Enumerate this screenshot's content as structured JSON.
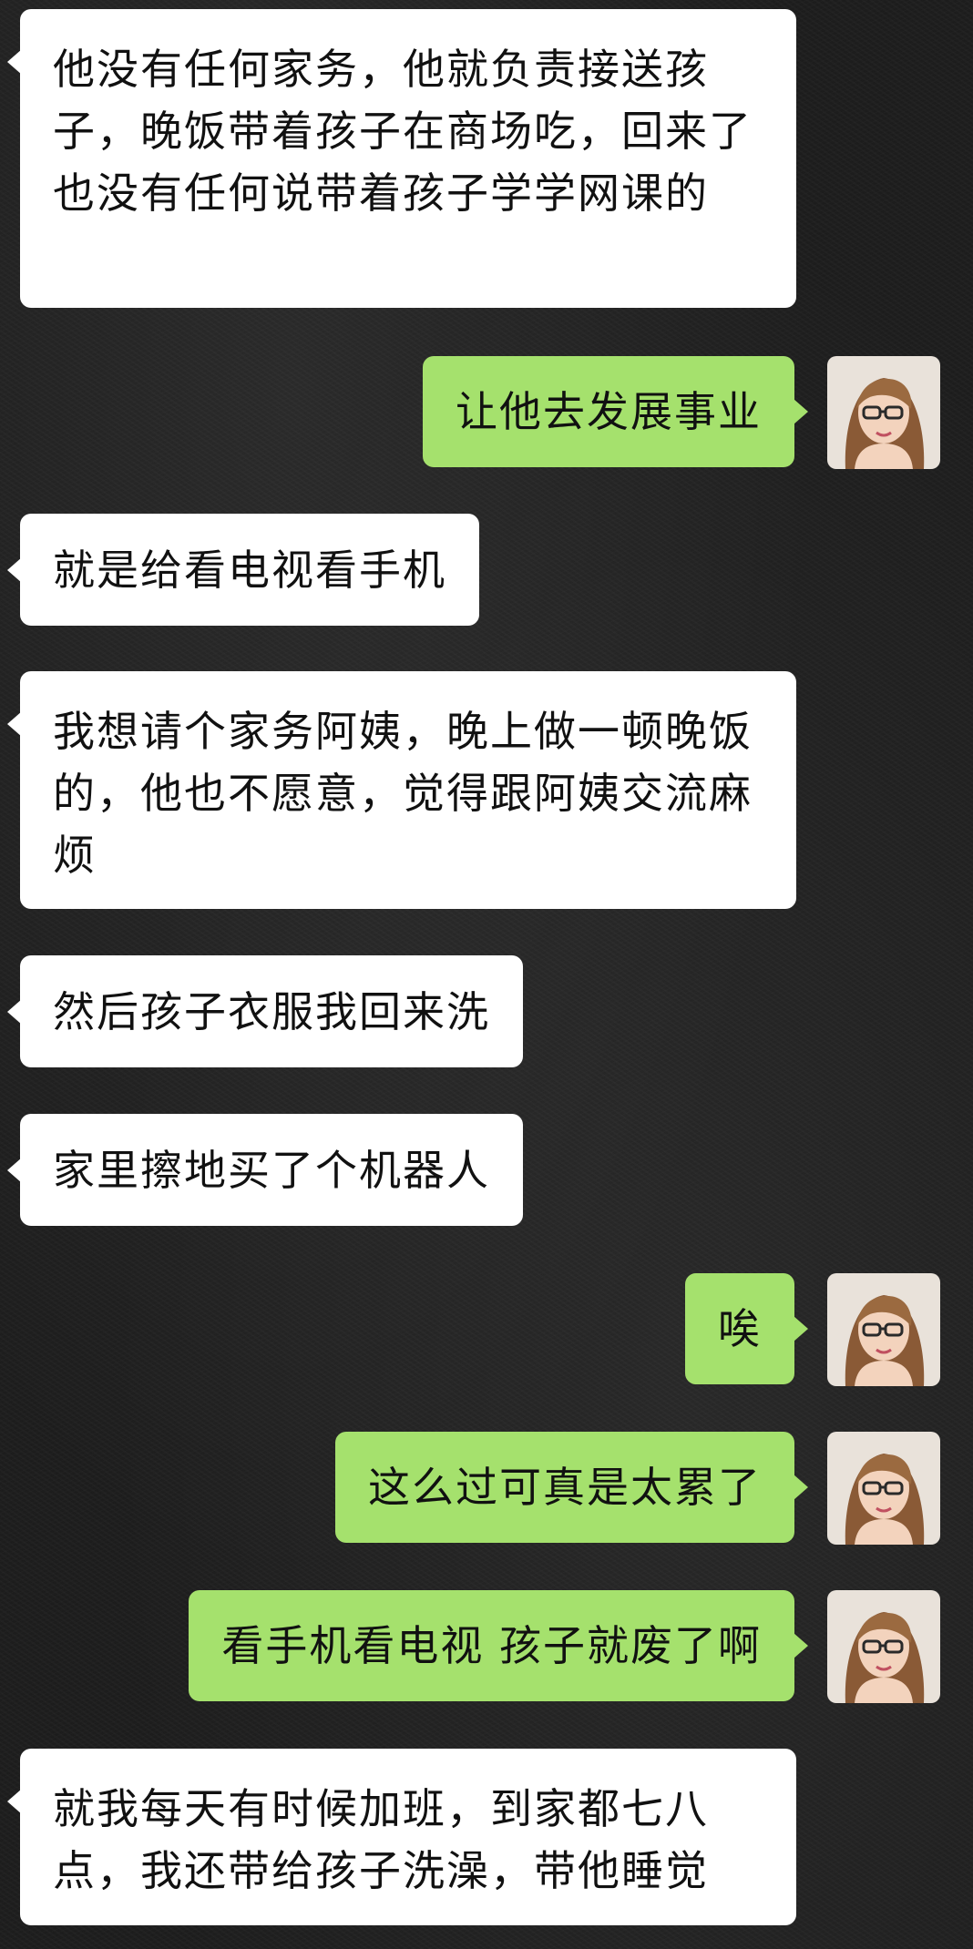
{
  "messages": [
    {
      "side": "in",
      "text": "他没有任何家务，他就负责接送孩子，晚饭带着孩子在商场吃，回来了也没有任何说带着孩子学学网课的"
    },
    {
      "side": "out",
      "text": "让他去发展事业"
    },
    {
      "side": "in",
      "text": "就是给看电视看手机"
    },
    {
      "side": "in",
      "text": "我想请个家务阿姨，晚上做一顿晚饭的，他也不愿意，觉得跟阿姨交流麻烦"
    },
    {
      "side": "in",
      "text": "然后孩子衣服我回来洗"
    },
    {
      "side": "in",
      "text": "家里擦地买了个机器人"
    },
    {
      "side": "out",
      "text": "唉"
    },
    {
      "side": "out",
      "text": "这么过可真是太累了"
    },
    {
      "side": "out",
      "text": "看手机看电视 孩子就废了啊"
    },
    {
      "side": "in",
      "text": "就我每天有时候加班，到家都七八点，我还带给孩子洗澡，带他睡觉"
    }
  ],
  "colors": {
    "incoming_bubble": "#ffffff",
    "outgoing_bubble": "#a5e16d",
    "background": "#1e1e1e"
  },
  "icons": {
    "avatar": "user-avatar-photo"
  }
}
